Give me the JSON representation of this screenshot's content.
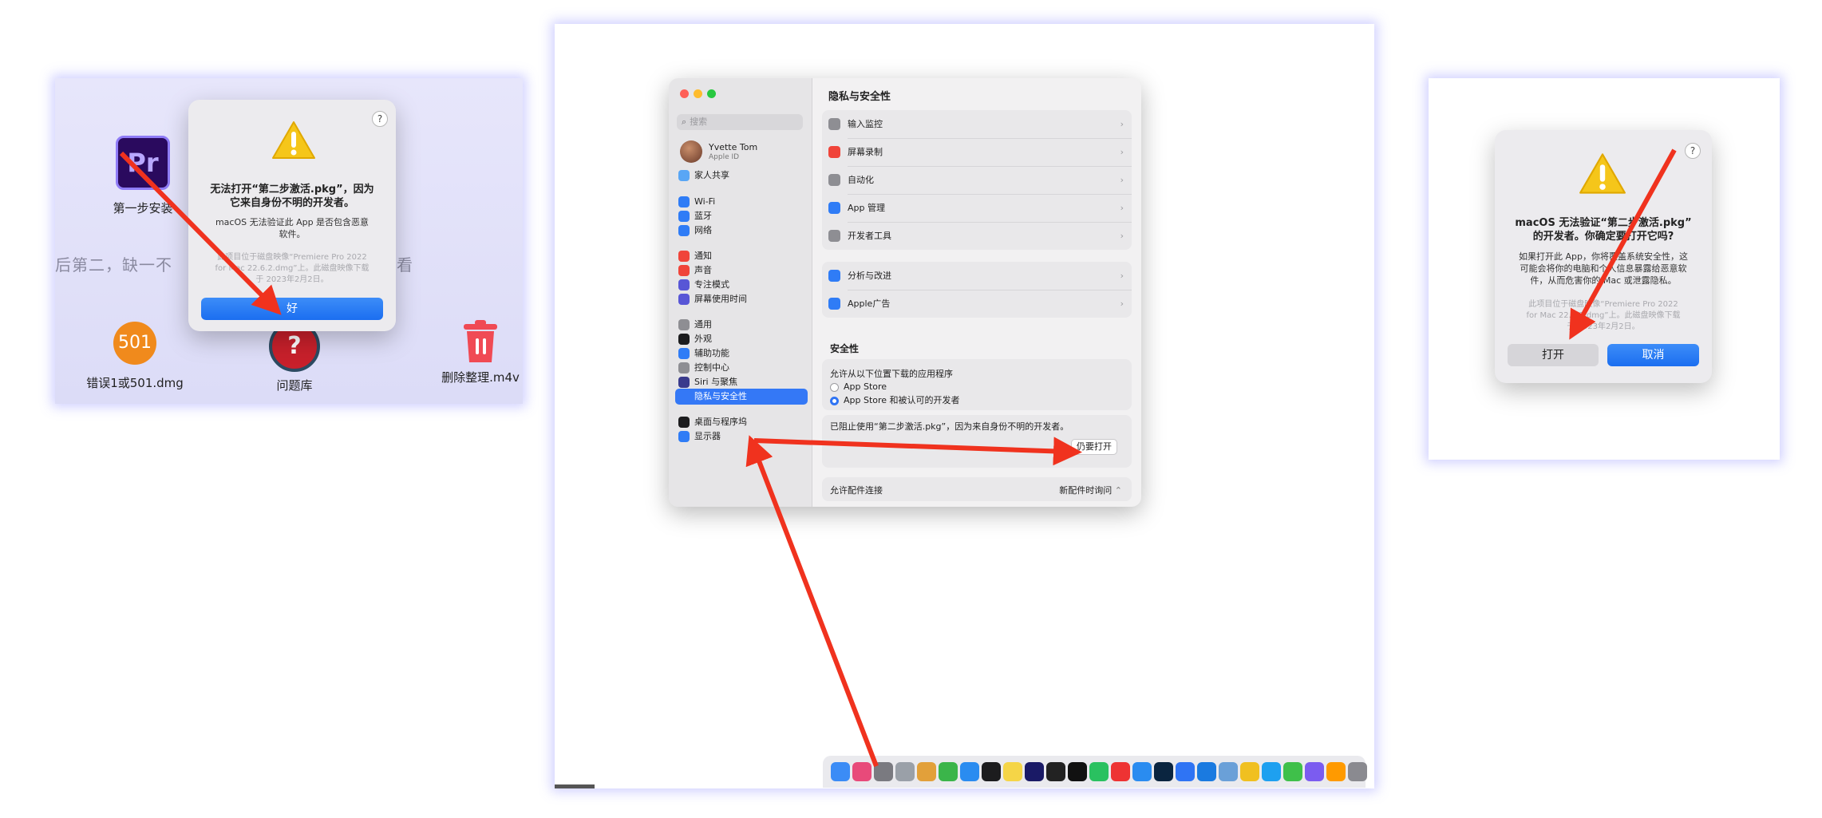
{
  "left_panel": {
    "desktop_icons": [
      {
        "label": "第一步安装",
        "glyph": "Pr"
      },
      {
        "label": "错误1或501.dmg",
        "glyph": "501"
      },
      {
        "label": "问题库",
        "glyph": "?"
      },
      {
        "label": "删除整理.m4v"
      }
    ],
    "bg_text_left": "后第二，缺一不",
    "bg_text_right": "看",
    "dialog": {
      "help": "?",
      "title_line1": "无法打开“第二步激活.pkg”，因为",
      "title_line2": "它来自身份不明的开发者。",
      "body_line1": "macOS 无法验证此 App 是否包含恶意",
      "body_line2": "软件。",
      "note_line1": "此项目位于磁盘映像“Premiere Pro 2022",
      "note_line2": "for Mac 22.6.2.dmg”上。此磁盘映像下载",
      "note_line3": "于 2023年2月2日。",
      "ok_button": "好"
    }
  },
  "middle_panel": {
    "search_placeholder": "搜索",
    "user": {
      "name": "Yvette Tom",
      "sub": "Apple ID"
    },
    "sidebar": [
      {
        "label": "家人共享",
        "color": "#59a6f5"
      },
      {
        "label": "Wi-Fi",
        "color": "#2f7cf6"
      },
      {
        "label": "蓝牙",
        "color": "#2f7cf6"
      },
      {
        "label": "网络",
        "color": "#2f7cf6"
      },
      {
        "label": "通知",
        "color": "#f0443a"
      },
      {
        "label": "声音",
        "color": "#f0443a"
      },
      {
        "label": "专注模式",
        "color": "#5856d6"
      },
      {
        "label": "屏幕使用时间",
        "color": "#5856d6"
      },
      {
        "label": "通用",
        "color": "#8e8e93"
      },
      {
        "label": "外观",
        "color": "#1c1c1e"
      },
      {
        "label": "辅助功能",
        "color": "#2f7cf6"
      },
      {
        "label": "控制中心",
        "color": "#8e8e93"
      },
      {
        "label": "Siri 与聚焦",
        "color": "#3a3a8c"
      },
      {
        "label": "隐私与安全性",
        "color": "#3478f6"
      },
      {
        "label": "桌面与程序坞",
        "color": "#1c1c1e"
      },
      {
        "label": "显示器",
        "color": "#2f7cf6"
      }
    ],
    "content_title": "隐私与安全性",
    "group1": [
      {
        "label": "输入监控",
        "color": "#8e8e93"
      },
      {
        "label": "屏幕录制",
        "color": "#f0443a"
      },
      {
        "label": "自动化",
        "color": "#8e8e93"
      },
      {
        "label": "App 管理",
        "color": "#2f7cf6"
      },
      {
        "label": "开发者工具",
        "color": "#8e8e93"
      }
    ],
    "group2": [
      {
        "label": "分析与改进",
        "color": "#2f7cf6"
      },
      {
        "label": "Apple广告",
        "color": "#2f7cf6"
      }
    ],
    "security_header": "安全性",
    "allow_label": "允许从以下位置下载的应用程序",
    "radio1": "App Store",
    "radio2": "App Store 和被认可的开发者",
    "blocked_text": "已阻止使用“第二步激活.pkg”，因为来自身份不明的开发者。",
    "open_anyway": "仍要打开",
    "accessory_label": "允许配件连接",
    "accessory_value": "新配件时询问",
    "chevron": "›",
    "updown": "⌃"
  },
  "right_panel": {
    "dialog": {
      "help": "?",
      "title_line1": "macOS 无法验证“第二步激活.pkg”",
      "title_line2": "的开发者。你确定要打开它吗?",
      "body_line1": "如果打开此 App，你将覆盖系统安全性，这",
      "body_line2": "可能会将你的电脑和个人信息暴露给恶意软",
      "body_line3": "件，从而危害你的 Mac 或泄露隐私。",
      "note_line1": "此项目位于磁盘映像“Premiere Pro 2022",
      "note_line2": "for Mac 22.6.2.dmg”上。此磁盘映像下载",
      "note_line3": "于 2023年2月2日。",
      "open_button": "打开",
      "cancel_button": "取消"
    }
  },
  "colors": {
    "accent": "#1b6ef0",
    "arrow": "#f0321e",
    "glow": "#8a8aff"
  }
}
